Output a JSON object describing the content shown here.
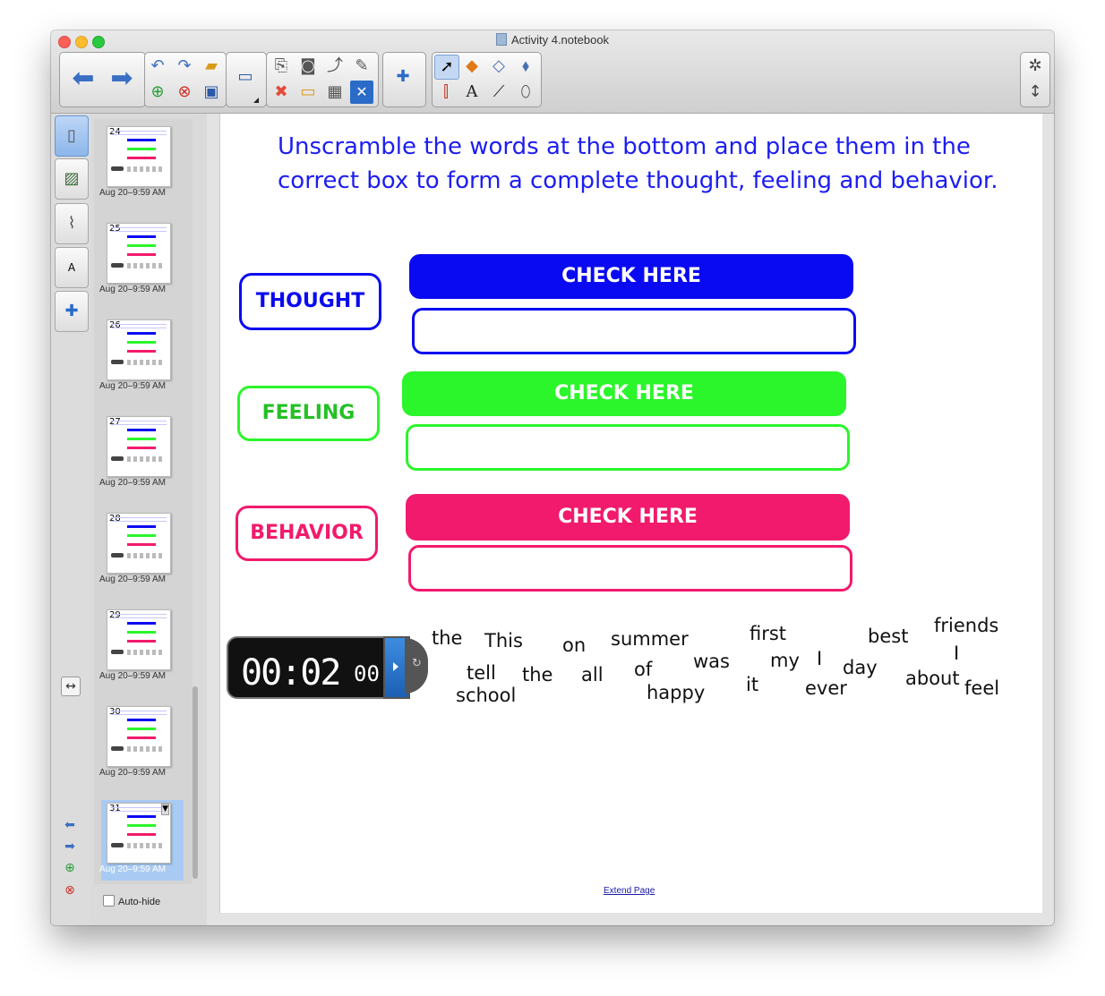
{
  "window": {
    "title": "Activity 4.notebook"
  },
  "toolbar": {
    "back_icon": "arrow-left-icon",
    "forward_icon": "arrow-right-icon",
    "undo_icon": "undo-icon",
    "redo_icon": "redo-icon",
    "open_icon": "folder-icon",
    "add_page_icon": "add-page-icon",
    "delete_page_icon": "delete-page-icon",
    "save_icon": "save-icon",
    "screen_icon": "screen-icon",
    "paste_icon": "paste-icon",
    "capture_icon": "camera-icon",
    "shade_icon": "screen-shade-icon",
    "recognize_icon": "handwriting-icon",
    "delete_icon": "delete-icon",
    "shade2_icon": "display-icon",
    "table_icon": "table-icon",
    "close_icon": "close-box-icon",
    "addon_icon": "puzzle-icon",
    "select_icon": "select-cursor-icon",
    "shapes_icon": "shapes-icon",
    "eraser_icon": "eraser-icon",
    "fill_icon": "fill-icon",
    "pens_icon": "pens-icon",
    "text_icon": "text-icon",
    "line_icon": "line-icon",
    "eraser2_icon": "eraser2-icon",
    "settings_icon": "gear-icon",
    "expand_icon": "expand-icon"
  },
  "sidebar": {
    "tabs": [
      "page-sorter-icon",
      "gallery-icon",
      "attachments-icon",
      "properties-icon",
      "addons-icon"
    ]
  },
  "pages": [
    {
      "num": "24",
      "time": "Aug 20–9:59 AM"
    },
    {
      "num": "25",
      "time": "Aug 20–9:59 AM"
    },
    {
      "num": "26",
      "time": "Aug 20–9:59 AM"
    },
    {
      "num": "27",
      "time": "Aug 20–9:59 AM"
    },
    {
      "num": "28",
      "time": "Aug 20–9:59 AM"
    },
    {
      "num": "29",
      "time": "Aug 20–9:59 AM"
    },
    {
      "num": "30",
      "time": "Aug 20–9:59 AM"
    },
    {
      "num": "31",
      "time": "Aug 20–9:59 AM"
    }
  ],
  "sorter": {
    "auto_hide_label": "Auto-hide"
  },
  "canvas": {
    "instruction_line1": "Unscramble the words at the bottom and place them in the",
    "instruction_line2": "correct box to form a complete thought, feeling and behavior.",
    "thought_label": "THOUGHT",
    "feeling_label": "FEELING",
    "behavior_label": "BEHAVIOR",
    "check_label": "CHECK HERE",
    "colors": {
      "thought": "#0a0af2",
      "feeling": "#2bf52b",
      "behavior": "#f21a6c"
    },
    "timer": {
      "display": "00:02",
      "sub": "00"
    },
    "words": [
      "the",
      "This",
      "on",
      "summer",
      "first",
      "best",
      "friends",
      "tell",
      "the",
      "all",
      "of",
      "was",
      "my",
      "I",
      "day",
      "I",
      "about",
      "feel",
      "school",
      "happy",
      "it",
      "ever"
    ],
    "extend_link": "Extend Page"
  }
}
